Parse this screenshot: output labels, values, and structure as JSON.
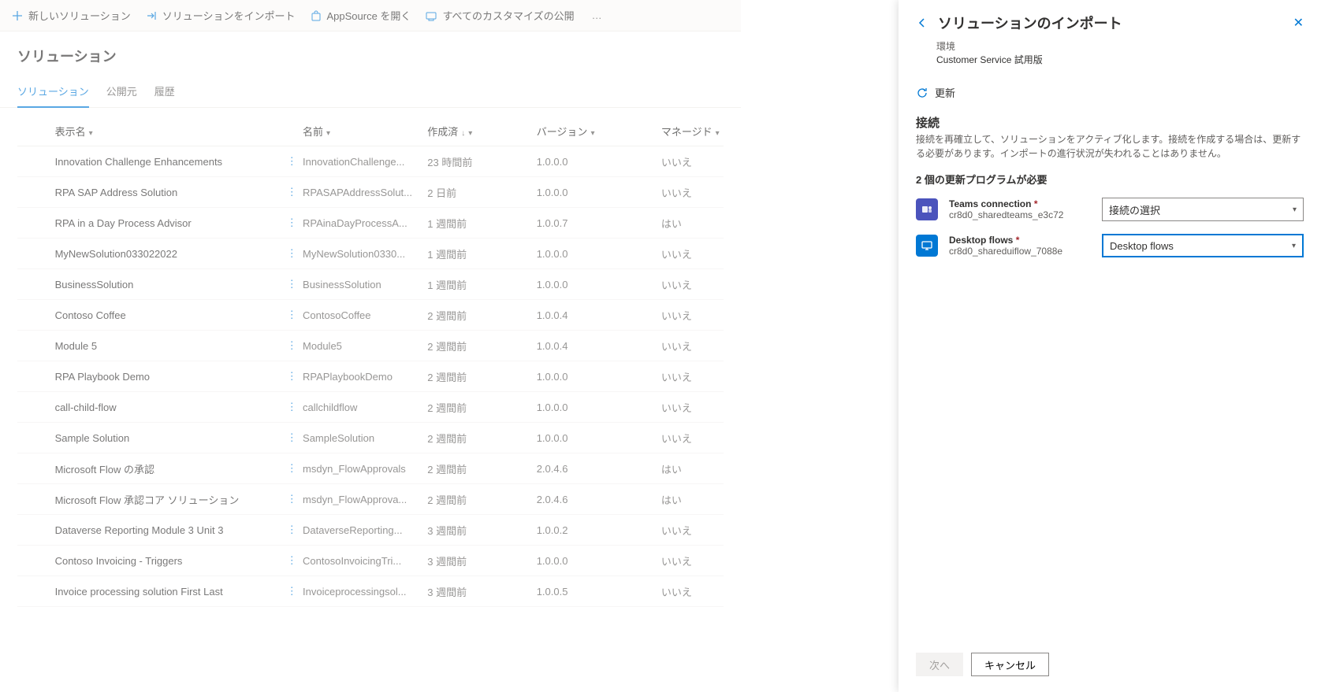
{
  "cmdbar": {
    "new": "新しいソリューション",
    "import": "ソリューションをインポート",
    "appsource": "AppSource を開く",
    "publish": "すべてのカスタマイズの公開",
    "more": "…"
  },
  "page": {
    "title": "ソリューション"
  },
  "tabs": {
    "solutions": "ソリューション",
    "publishers": "公開元",
    "history": "履歴"
  },
  "grid": {
    "cols": {
      "display": "表示名",
      "name": "名前",
      "created": "作成済",
      "version": "バージョン",
      "managed": "マネージド"
    },
    "rows": [
      {
        "display": "Innovation Challenge Enhancements",
        "name": "InnovationChallenge...",
        "created": "23 時間前",
        "version": "1.0.0.0",
        "managed": "いいえ"
      },
      {
        "display": "RPA SAP Address Solution",
        "name": "RPASAPAddressSolut...",
        "created": "2 日前",
        "version": "1.0.0.0",
        "managed": "いいえ"
      },
      {
        "display": "RPA in a Day Process Advisor",
        "name": "RPAinaDayProcessA...",
        "created": "1 週間前",
        "version": "1.0.0.7",
        "managed": "はい"
      },
      {
        "display": "MyNewSolution033022022",
        "name": "MyNewSolution0330...",
        "created": "1 週間前",
        "version": "1.0.0.0",
        "managed": "いいえ"
      },
      {
        "display": "BusinessSolution",
        "name": "BusinessSolution",
        "created": "1 週間前",
        "version": "1.0.0.0",
        "managed": "いいえ"
      },
      {
        "display": "Contoso Coffee",
        "name": "ContosoCoffee",
        "created": "2 週間前",
        "version": "1.0.0.4",
        "managed": "いいえ"
      },
      {
        "display": "Module 5",
        "name": "Module5",
        "created": "2 週間前",
        "version": "1.0.0.4",
        "managed": "いいえ"
      },
      {
        "display": "RPA Playbook Demo",
        "name": "RPAPlaybookDemo",
        "created": "2 週間前",
        "version": "1.0.0.0",
        "managed": "いいえ"
      },
      {
        "display": "call-child-flow",
        "name": "callchildflow",
        "created": "2 週間前",
        "version": "1.0.0.0",
        "managed": "いいえ"
      },
      {
        "display": "Sample Solution",
        "name": "SampleSolution",
        "created": "2 週間前",
        "version": "1.0.0.0",
        "managed": "いいえ"
      },
      {
        "display": "Microsoft Flow の承認",
        "name": "msdyn_FlowApprovals",
        "created": "2 週間前",
        "version": "2.0.4.6",
        "managed": "はい"
      },
      {
        "display": "Microsoft Flow 承認コア ソリューション",
        "name": "msdyn_FlowApprova...",
        "created": "2 週間前",
        "version": "2.0.4.6",
        "managed": "はい"
      },
      {
        "display": "Dataverse Reporting Module 3 Unit 3",
        "name": "DataverseReporting...",
        "created": "3 週間前",
        "version": "1.0.0.2",
        "managed": "いいえ"
      },
      {
        "display": "Contoso Invoicing - Triggers",
        "name": "ContosoInvoicingTri...",
        "created": "3 週間前",
        "version": "1.0.0.0",
        "managed": "いいえ"
      },
      {
        "display": "Invoice processing solution First Last",
        "name": "Invoiceprocessingsol...",
        "created": "3 週間前",
        "version": "1.0.0.5",
        "managed": "いいえ"
      }
    ]
  },
  "panel": {
    "title": "ソリューションのインポート",
    "env_label": "環境",
    "env_name": "Customer Service 試用版",
    "refresh": "更新",
    "sec_title": "接続",
    "sec_desc": "接続を再確立して、ソリューションをアクティブ化します。接続を作成する場合は、更新する必要があります。インポートの進行状況が失われることはありません。",
    "sec_sub": "2 個の更新プログラムが必要",
    "conns": [
      {
        "name": "Teams connection",
        "id": "cr8d0_sharedteams_e3c72",
        "select": "接続の選択",
        "icon": "teams"
      },
      {
        "name": "Desktop flows",
        "id": "cr8d0_shareduiflow_7088e",
        "select": "Desktop flows",
        "icon": "desktop",
        "focus": true
      }
    ],
    "next": "次へ",
    "cancel": "キャンセル"
  }
}
